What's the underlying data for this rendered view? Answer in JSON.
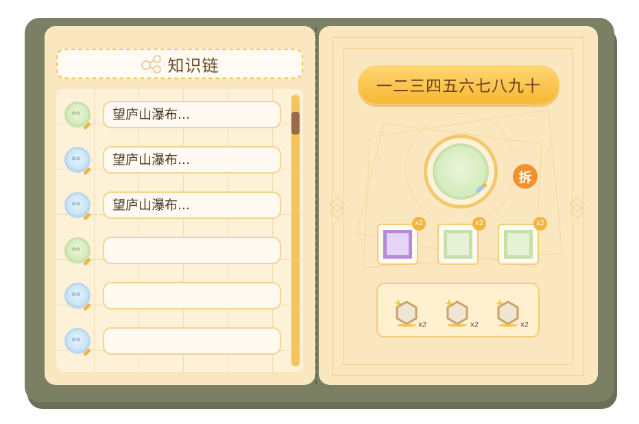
{
  "left_page": {
    "title": "知识链",
    "title_icon": "share-link-icon",
    "rows": [
      {
        "text": "望庐山瀑布...",
        "icon": "chain-link-icon",
        "color": "green"
      },
      {
        "text": "望庐山瀑布...",
        "icon": "chain-link-icon",
        "color": "blue"
      },
      {
        "text": "望庐山瀑布...",
        "icon": "chain-link-icon",
        "color": "blue"
      },
      {
        "text": "",
        "icon": "chain-link-icon",
        "color": "green"
      },
      {
        "text": "",
        "icon": "chain-link-icon",
        "color": "blue"
      },
      {
        "text": "",
        "icon": "chain-link-icon",
        "color": "blue"
      }
    ]
  },
  "right_page": {
    "title": "一二三四五六七八九十",
    "dismantle_label": "拆",
    "slots": [
      {
        "color": "purple",
        "count": "x2"
      },
      {
        "color": "green",
        "count": "x2"
      },
      {
        "color": "green",
        "count": "x2"
      }
    ],
    "rewards": [
      {
        "icon": "hexagon-gem-icon",
        "count": "x2"
      },
      {
        "icon": "hexagon-gem-icon",
        "count": "x2"
      },
      {
        "icon": "hexagon-gem-icon",
        "count": "x2"
      }
    ]
  },
  "colors": {
    "cover": "#7b7f63",
    "page": "#fbe7bf",
    "accent": "#f6b832",
    "dismantle": "#f2922e"
  }
}
